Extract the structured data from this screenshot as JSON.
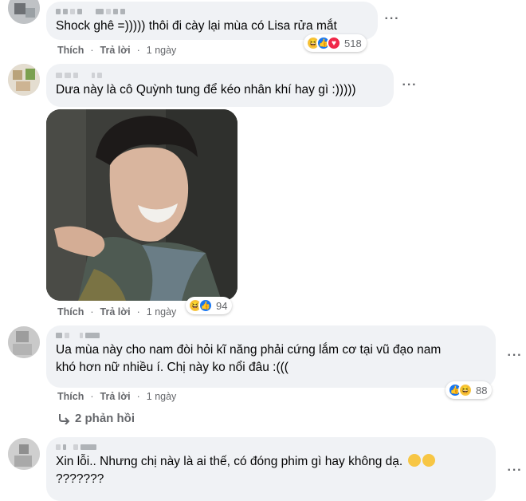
{
  "comments": [
    {
      "text": "Shock ghê =))))) thôi đi cày lại mùa có Lisa rửa mắt",
      "like": "Thích",
      "reply": "Trả lời",
      "time": "1 ngày",
      "reactions": [
        "haha",
        "like",
        "love"
      ],
      "reaction_count": "518"
    },
    {
      "text": "Dưa này là cô Quỳnh tung để kéo nhân khí hay gì :)))))",
      "like": "Thích",
      "reply": "Trả lời",
      "time": "1 ngày",
      "reactions": [
        "haha",
        "like"
      ],
      "reaction_count": "94",
      "has_photo": true
    },
    {
      "text": "Ua mùa này cho nam đòi hỏi kĩ năng phải cứng lắm cơ tại vũ đạo nam\nkhó hơn nữ nhiều í. Chị này ko nổi đâu :(((",
      "like": "Thích",
      "reply": "Trả lời",
      "time": "1 ngày",
      "reactions": [
        "like",
        "haha"
      ],
      "reaction_count": "88",
      "replies_label": "2 phản hồi"
    },
    {
      "text": "Xin lỗi.. Nhưng chị này là ai thế, có đóng phim gì hay không dạ.",
      "text_line2": "???????",
      "reactions": [
        "sweat",
        "sweat"
      ]
    }
  ],
  "icons": {
    "more": "more-horizontal-icon",
    "reply_arrow": "reply-arrow-icon"
  },
  "colors": {
    "bubble": "#f0f2f5",
    "meta": "#65676b",
    "like_blue": "#1877f2",
    "love_red": "#f02849",
    "haha_yellow": "#f7c644"
  }
}
